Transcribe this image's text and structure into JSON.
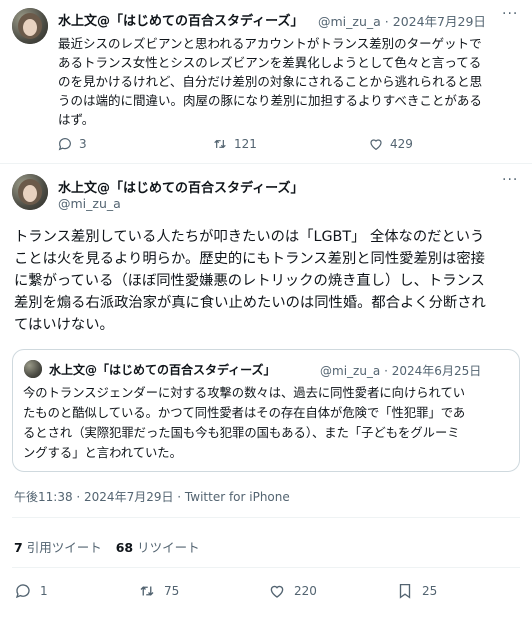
{
  "tweet1": {
    "author_name": "水上文@「はじめての百合スタディーズ」",
    "handle": "@mi_zu_a",
    "separator": "·",
    "date": "2024年7月29日",
    "body_lines": [
      "最近シスのレズビアンと思われるアカウントがトランス差別のターゲットで",
      "あるトランス女性とシスのレズビアンを差異化しようとして色々と言ってる",
      "のを見かけるけれど、自分だけ差別の対象にされることから逃れられると思",
      "うのは端的に間違い。肉屋の豚になり差別に加担するよりすべきことがある",
      "はず。"
    ],
    "replies": "3",
    "retweets": "121",
    "likes": "429"
  },
  "tweet2": {
    "author_name": "水上文@「はじめての百合スタディーズ」",
    "handle": "@mi_zu_a",
    "body_lines": [
      "トランス差別している人たちが叩きたいのは「LGBT」 全体なのだという",
      "ことは火を見るより明らか。歴史的にもトランス差別と同性愛差別は密接",
      "に繋がっている（ほぼ同性愛嫌悪のレトリックの焼き直し）し、トランス",
      "差別を煽る右派政治家が真に食い止めたいのは同性婚。都合よく分断され",
      "てはいけない。"
    ],
    "quote": {
      "author_name": "水上文@「はじめての百合スタディーズ」",
      "handle": "@mi_zu_a",
      "separator": "·",
      "date": "2024年6月25日",
      "body_lines": [
        "今のトランスジェンダーに対する攻撃の数々は、過去に同性愛者に向けられてい",
        "たものと酷似している。かつて同性愛者はその存在自体が危険で「性犯罪」であ",
        "るとされ（実際犯罪だった国も今も犯罪の国もある）、また「子どもをグルーミ",
        "ングする」と言われていた。"
      ]
    },
    "timestamp": "午後11:38 · 2024年7月29日 · Twitter for iPhone",
    "quote_tweets_count": "7",
    "quote_tweets_label": "引用ツイート",
    "retweets_count": "68",
    "retweets_label": "リツイート",
    "replies": "1",
    "retweets": "75",
    "likes": "220",
    "bookmarks": "25"
  },
  "icons": {
    "reply": "reply-icon",
    "retweet": "retweet-icon",
    "like": "heart-icon",
    "bookmark": "bookmark-icon",
    "more": "more-icon"
  },
  "colors": {
    "text": "#0f1419",
    "secondary": "#536471",
    "border": "#cfd9de"
  }
}
